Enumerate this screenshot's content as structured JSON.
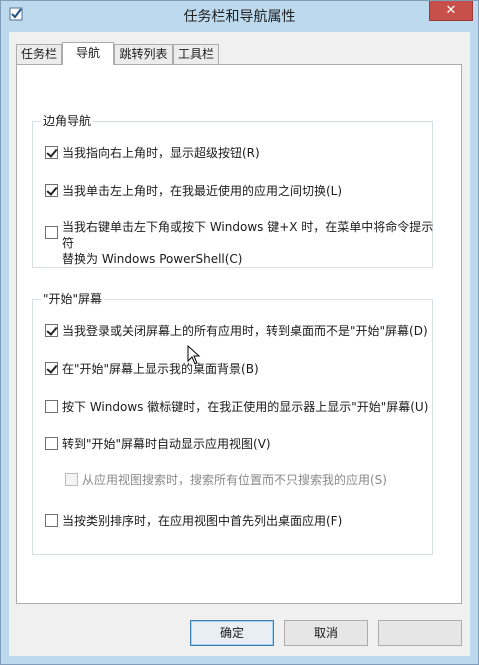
{
  "window": {
    "title": "任务栏和导航属性",
    "close_symbol": "✕",
    "app_icon": "checkbox-app-icon"
  },
  "tabs": [
    {
      "label": "任务栏",
      "active": false
    },
    {
      "label": "导航",
      "active": true
    },
    {
      "label": "跳转列表",
      "active": false
    },
    {
      "label": "工具栏",
      "active": false
    }
  ],
  "corner_nav": {
    "title": "边角导航",
    "options": [
      {
        "label": "当我指向右上角时，显示超级按钮(R)",
        "checked": true
      },
      {
        "label": "当我单击左上角时，在我最近使用的应用之间切换(L)",
        "checked": true
      },
      {
        "label_line1": "当我右键单击左下角或按下 Windows 键+X 时，在菜单中将命令提示符",
        "label_line2": "替换为 Windows PowerShell(C)",
        "checked": false
      }
    ]
  },
  "start_screen": {
    "title": "\"开始\"屏幕",
    "options": [
      {
        "label": "当我登录或关闭屏幕上的所有应用时，转到桌面而不是\"开始\"屏幕(D)",
        "checked": true
      },
      {
        "label": "在\"开始\"屏幕上显示我的桌面背景(B)",
        "checked": true
      },
      {
        "label": "按下 Windows 徽标键时，在我正使用的显示器上显示\"开始\"屏幕(U)",
        "checked": false
      },
      {
        "label": "转到\"开始\"屏幕时自动显示应用视图(V)",
        "checked": false
      },
      {
        "label": "从应用视图搜索时，搜索所有位置而不只搜索我的应用(S)",
        "checked": false,
        "disabled": true
      },
      {
        "label": "当按类别排序时，在应用视图中首先列出桌面应用(F)",
        "checked": false
      }
    ]
  },
  "buttons": {
    "ok": "确定",
    "cancel": "取消"
  },
  "colors": {
    "frame": "#bcd9ee",
    "close": "#c7504a",
    "dialog": "#f0f0f0"
  }
}
